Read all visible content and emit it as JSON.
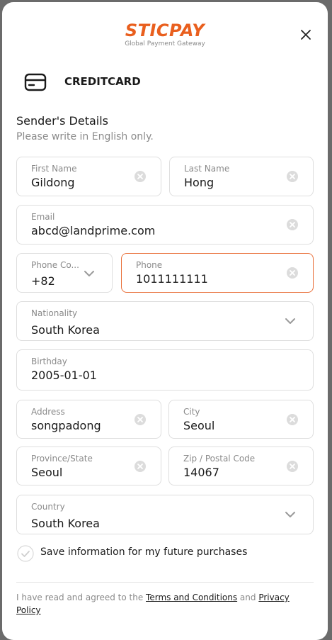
{
  "brand": {
    "name": "STICPAY",
    "tagline": "Global Payment Gateway",
    "accent_color": "#e95f1e"
  },
  "payment_method": {
    "icon": "credit-card-icon",
    "label": "CREDITCARD"
  },
  "section": {
    "title": "Sender's Details",
    "subtitle": "Please write in English only."
  },
  "fields": {
    "first_name": {
      "label": "First Name",
      "value": "Gildong"
    },
    "last_name": {
      "label": "Last Name",
      "value": "Hong"
    },
    "email": {
      "label": "Email",
      "value": "abcd@landprime.com"
    },
    "phone_code": {
      "label": "Phone Co...",
      "value": "+82"
    },
    "phone": {
      "label": "Phone",
      "value": "1011111111"
    },
    "nationality": {
      "label": "Nationality",
      "value": "South Korea"
    },
    "birthday": {
      "label": "Birthday",
      "value": "2005-01-01"
    },
    "address": {
      "label": "Address",
      "value": "songpadong"
    },
    "city": {
      "label": "City",
      "value": "Seoul"
    },
    "province": {
      "label": "Province/State",
      "value": "Seoul"
    },
    "zip": {
      "label": "Zip / Postal Code",
      "value": "14067"
    },
    "country": {
      "label": "Country",
      "value": "South Korea"
    }
  },
  "save_info": {
    "label": "Save information for my future purchases"
  },
  "terms": {
    "prefix": "I have read and agreed to the ",
    "terms_link": "Terms and Conditions",
    "middle": " and ",
    "privacy_link": "Privacy Policy"
  }
}
